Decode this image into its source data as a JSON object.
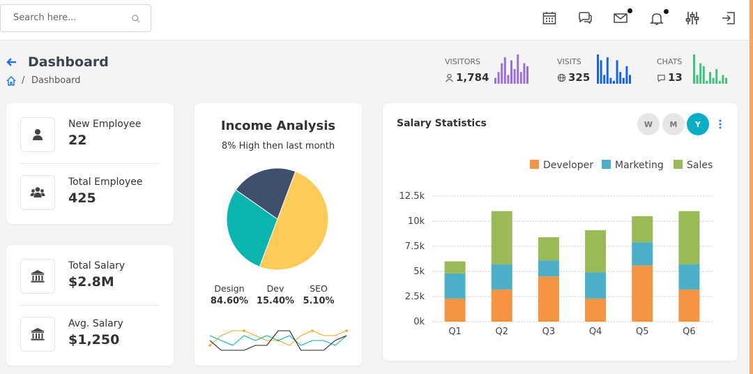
{
  "header": {
    "search_placeholder": "Search here...",
    "icons": [
      "calendar-icon",
      "chat-icon",
      "mail-icon",
      "bell-icon",
      "sliders-icon",
      "logout-icon"
    ]
  },
  "page": {
    "title": "Dashboard",
    "breadcrumb": [
      "Dashboard"
    ]
  },
  "stats": [
    {
      "label": "VISITORS",
      "value": "1,784",
      "color": "#9b6fd6",
      "bars": [
        2,
        4,
        7,
        9,
        3,
        8,
        5,
        10,
        4,
        7,
        6
      ]
    },
    {
      "label": "VISITS",
      "value": "325",
      "color": "#1565e6",
      "bars": [
        10,
        8,
        3,
        9,
        2,
        1,
        8,
        4,
        2,
        6,
        3
      ]
    },
    {
      "label": "CHATS",
      "value": "13",
      "color": "#41c27c",
      "bars": [
        10,
        3,
        7,
        6,
        1,
        4,
        2,
        5,
        1,
        3,
        2
      ]
    }
  ],
  "employees": {
    "new_label": "New Employee",
    "new_value": "22",
    "total_label": "Total Employee",
    "total_value": "425"
  },
  "salary_summary": {
    "total_label": "Total Salary",
    "total_value": "$2.8M",
    "avg_label": "Avg. Salary",
    "avg_value": "$1,250"
  },
  "income": {
    "title": "Income Analysis",
    "subtitle": "8% High then last month",
    "legend": [
      {
        "label": "Design",
        "value": "84.60%"
      },
      {
        "label": "Dev",
        "value": "15.40%"
      },
      {
        "label": "SEO",
        "value": "5.10%"
      }
    ]
  },
  "salary_stats": {
    "title": "Salary Statistics",
    "periods": [
      "W",
      "M",
      "Y"
    ],
    "active_period": "Y"
  },
  "chart_data": [
    {
      "type": "pie",
      "slices": [
        {
          "value": 50,
          "color": "#fecb59"
        },
        {
          "value": 29,
          "color": "#0ab5b0"
        },
        {
          "value": 21,
          "color": "#3f4f6c"
        }
      ]
    },
    {
      "type": "line",
      "series": [
        {
          "color": "#f5a623",
          "values": [
            2,
            4,
            5,
            5,
            4,
            3,
            3,
            2,
            4,
            5,
            4,
            4,
            5
          ]
        },
        {
          "color": "#0ab5b0",
          "values": [
            4,
            3,
            2,
            4,
            3,
            4,
            3,
            4,
            2,
            3,
            3,
            2,
            4
          ]
        },
        {
          "color": "#222222",
          "values": [
            3,
            1,
            1,
            1,
            2,
            2,
            5,
            5,
            1,
            1,
            1,
            3,
            4
          ]
        }
      ]
    },
    {
      "type": "bar",
      "stacked": true,
      "categories": [
        "Q1",
        "Q2",
        "Q3",
        "Q4",
        "Q5",
        "Q6"
      ],
      "series": [
        {
          "name": "Developer",
          "color": "#f59443",
          "values": [
            2300,
            3200,
            4500,
            2300,
            5600,
            3200
          ]
        },
        {
          "name": "Marketing",
          "color": "#4bafc9",
          "values": [
            2500,
            2500,
            1600,
            2600,
            2300,
            2500
          ]
        },
        {
          "name": "Sales",
          "color": "#9aba57",
          "values": [
            1200,
            5300,
            2300,
            4200,
            2600,
            5300
          ]
        }
      ],
      "y_ticks": [
        "0k",
        "2.5k",
        "5k",
        "7.5k",
        "10k",
        "12.5k"
      ],
      "ylim": [
        0,
        12500
      ],
      "legend": "top-right",
      "grid": true
    }
  ]
}
